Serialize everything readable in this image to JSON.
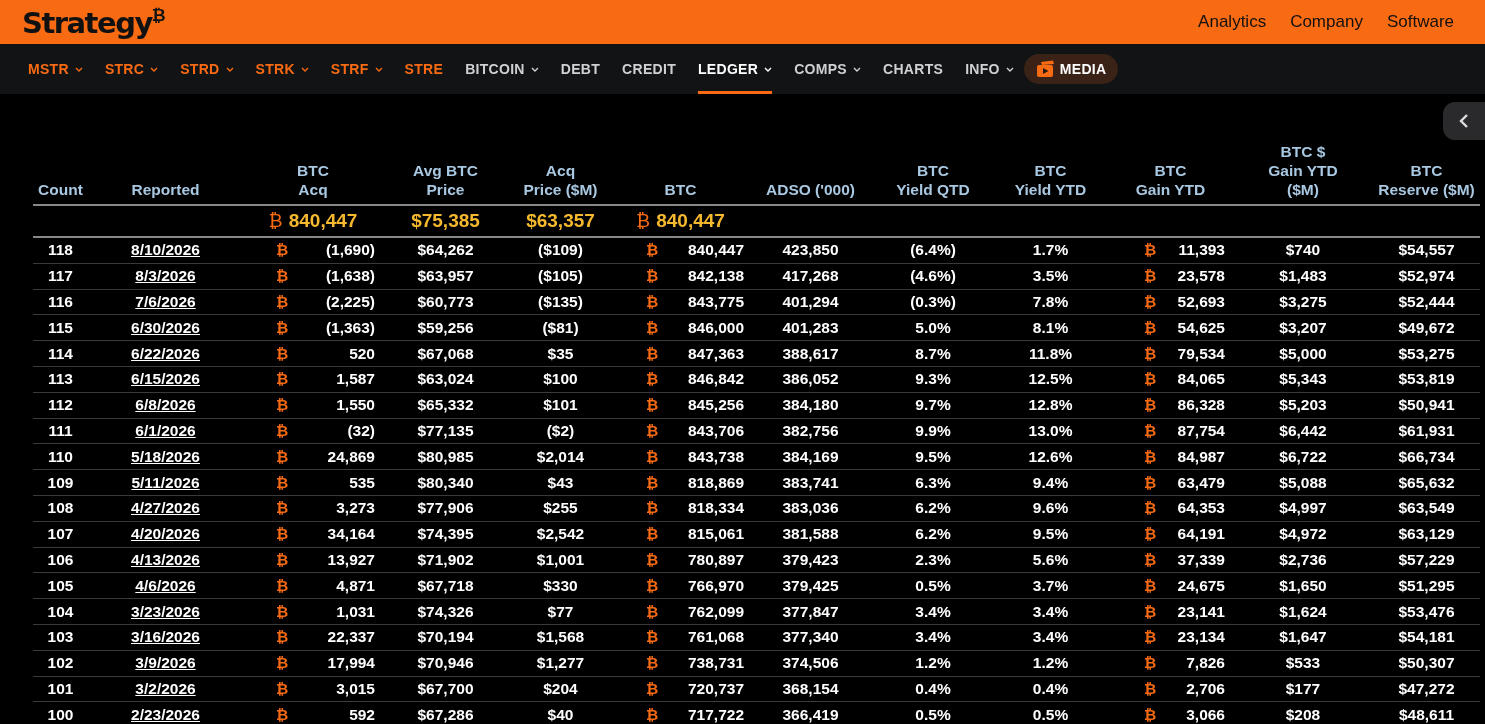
{
  "brand": {
    "logo": "Strategy$^{₿}$"
  },
  "top_links": [
    "Analytics",
    "Company",
    "Software"
  ],
  "nav": [
    {
      "label": "MSTR",
      "kind": "ticker",
      "caret": true,
      "selected": false
    },
    {
      "label": "STRC",
      "kind": "ticker",
      "caret": true,
      "selected": false
    },
    {
      "label": "STRD",
      "kind": "ticker",
      "caret": true,
      "selected": false
    },
    {
      "label": "STRK",
      "kind": "ticker",
      "caret": true,
      "selected": false
    },
    {
      "label": "STRF",
      "kind": "ticker",
      "caret": true,
      "selected": false
    },
    {
      "label": "STRE",
      "kind": "ticker",
      "caret": false,
      "selected": false
    },
    {
      "label": "BITCOIN",
      "kind": "section",
      "caret": true,
      "selected": false
    },
    {
      "label": "DEBT",
      "kind": "section",
      "caret": false,
      "selected": false
    },
    {
      "label": "CREDIT",
      "kind": "section",
      "caret": false,
      "selected": false
    },
    {
      "label": "LEDGER",
      "kind": "section",
      "caret": true,
      "selected": true
    },
    {
      "label": "COMPS",
      "kind": "section",
      "caret": true,
      "selected": false
    },
    {
      "label": "CHARTS",
      "kind": "section",
      "caret": false,
      "selected": false
    },
    {
      "label": "INFO",
      "kind": "section",
      "caret": true,
      "selected": false
    },
    {
      "label": "MEDIA",
      "kind": "media",
      "selected": false
    }
  ],
  "table": {
    "columns": [
      {
        "lines": [
          "Count"
        ],
        "kind": "text"
      },
      {
        "lines": [
          "Reported"
        ],
        "kind": "link"
      },
      {
        "lines": [
          "BTC",
          "Acq"
        ],
        "kind": "btc",
        "total": {
          "unit": "₿",
          "value": "840,447"
        }
      },
      {
        "lines": [
          "Avg BTC",
          "Price"
        ],
        "kind": "text",
        "total": "$75,385"
      },
      {
        "lines": [
          "Acq",
          "Price ($M)"
        ],
        "kind": "text",
        "total": "$63,357"
      },
      {
        "lines": [
          "BTC"
        ],
        "kind": "btc",
        "total": {
          "unit": "₿",
          "value": "840,447"
        }
      },
      {
        "lines": [
          "ADSO ('000)"
        ],
        "kind": "text"
      },
      {
        "lines": [
          "BTC",
          "Yield QTD"
        ],
        "kind": "text"
      },
      {
        "lines": [
          "BTC",
          "Yield YTD"
        ],
        "kind": "text"
      },
      {
        "lines": [
          "BTC",
          "Gain YTD"
        ],
        "kind": "btc"
      },
      {
        "lines": [
          "BTC $",
          "Gain YTD",
          "($M)"
        ],
        "kind": "text"
      },
      {
        "lines": [
          "BTC",
          "Reserve ($M)"
        ],
        "kind": "text"
      }
    ],
    "rows": [
      [
        "118",
        "8/10/2026",
        {
          "unit": "₿",
          "value": "(1,690)"
        },
        "$64,262",
        "($109)",
        {
          "unit": "₿",
          "value": "840,447"
        },
        "423,850",
        "(6.4%)",
        "1.7%",
        {
          "unit": "₿",
          "value": "11,393"
        },
        "$740",
        "$54,557"
      ],
      [
        "117",
        "8/3/2026",
        {
          "unit": "₿",
          "value": "(1,638)"
        },
        "$63,957",
        "($105)",
        {
          "unit": "₿",
          "value": "842,138"
        },
        "417,268",
        "(4.6%)",
        "3.5%",
        {
          "unit": "₿",
          "value": "23,578"
        },
        "$1,483",
        "$52,974"
      ],
      [
        "116",
        "7/6/2026",
        {
          "unit": "₿",
          "value": "(2,225)"
        },
        "$60,773",
        "($135)",
        {
          "unit": "₿",
          "value": "843,775"
        },
        "401,294",
        "(0.3%)",
        "7.8%",
        {
          "unit": "₿",
          "value": "52,693"
        },
        "$3,275",
        "$52,444"
      ],
      [
        "115",
        "6/30/2026",
        {
          "unit": "₿",
          "value": "(1,363)"
        },
        "$59,256",
        "($81)",
        {
          "unit": "₿",
          "value": "846,000"
        },
        "401,283",
        "5.0%",
        "8.1%",
        {
          "unit": "₿",
          "value": "54,625"
        },
        "$3,207",
        "$49,672"
      ],
      [
        "114",
        "6/22/2026",
        {
          "unit": "₿",
          "value": "520"
        },
        "$67,068",
        "$35",
        {
          "unit": "₿",
          "value": "847,363"
        },
        "388,617",
        "8.7%",
        "11.8%",
        {
          "unit": "₿",
          "value": "79,534"
        },
        "$5,000",
        "$53,275"
      ],
      [
        "113",
        "6/15/2026",
        {
          "unit": "₿",
          "value": "1,587"
        },
        "$63,024",
        "$100",
        {
          "unit": "₿",
          "value": "846,842"
        },
        "386,052",
        "9.3%",
        "12.5%",
        {
          "unit": "₿",
          "value": "84,065"
        },
        "$5,343",
        "$53,819"
      ],
      [
        "112",
        "6/8/2026",
        {
          "unit": "₿",
          "value": "1,550"
        },
        "$65,332",
        "$101",
        {
          "unit": "₿",
          "value": "845,256"
        },
        "384,180",
        "9.7%",
        "12.8%",
        {
          "unit": "₿",
          "value": "86,328"
        },
        "$5,203",
        "$50,941"
      ],
      [
        "111",
        "6/1/2026",
        {
          "unit": "₿",
          "value": "(32)"
        },
        "$77,135",
        "($2)",
        {
          "unit": "₿",
          "value": "843,706"
        },
        "382,756",
        "9.9%",
        "13.0%",
        {
          "unit": "₿",
          "value": "87,754"
        },
        "$6,442",
        "$61,931"
      ],
      [
        "110",
        "5/18/2026",
        {
          "unit": "₿",
          "value": "24,869"
        },
        "$80,985",
        "$2,014",
        {
          "unit": "₿",
          "value": "843,738"
        },
        "384,169",
        "9.5%",
        "12.6%",
        {
          "unit": "₿",
          "value": "84,987"
        },
        "$6,722",
        "$66,734"
      ],
      [
        "109",
        "5/11/2026",
        {
          "unit": "₿",
          "value": "535"
        },
        "$80,340",
        "$43",
        {
          "unit": "₿",
          "value": "818,869"
        },
        "383,741",
        "6.3%",
        "9.4%",
        {
          "unit": "₿",
          "value": "63,479"
        },
        "$5,088",
        "$65,632"
      ],
      [
        "108",
        "4/27/2026",
        {
          "unit": "₿",
          "value": "3,273"
        },
        "$77,906",
        "$255",
        {
          "unit": "₿",
          "value": "818,334"
        },
        "383,036",
        "6.2%",
        "9.6%",
        {
          "unit": "₿",
          "value": "64,353"
        },
        "$4,997",
        "$63,549"
      ],
      [
        "107",
        "4/20/2026",
        {
          "unit": "₿",
          "value": "34,164"
        },
        "$74,395",
        "$2,542",
        {
          "unit": "₿",
          "value": "815,061"
        },
        "381,588",
        "6.2%",
        "9.5%",
        {
          "unit": "₿",
          "value": "64,191"
        },
        "$4,972",
        "$63,129"
      ],
      [
        "106",
        "4/13/2026",
        {
          "unit": "₿",
          "value": "13,927"
        },
        "$71,902",
        "$1,001",
        {
          "unit": "₿",
          "value": "780,897"
        },
        "379,423",
        "2.3%",
        "5.6%",
        {
          "unit": "₿",
          "value": "37,339"
        },
        "$2,736",
        "$57,229"
      ],
      [
        "105",
        "4/6/2026",
        {
          "unit": "₿",
          "value": "4,871"
        },
        "$67,718",
        "$330",
        {
          "unit": "₿",
          "value": "766,970"
        },
        "379,425",
        "0.5%",
        "3.7%",
        {
          "unit": "₿",
          "value": "24,675"
        },
        "$1,650",
        "$51,295"
      ],
      [
        "104",
        "3/23/2026",
        {
          "unit": "₿",
          "value": "1,031"
        },
        "$74,326",
        "$77",
        {
          "unit": "₿",
          "value": "762,099"
        },
        "377,847",
        "3.4%",
        "3.4%",
        {
          "unit": "₿",
          "value": "23,141"
        },
        "$1,624",
        "$53,476"
      ],
      [
        "103",
        "3/16/2026",
        {
          "unit": "₿",
          "value": "22,337"
        },
        "$70,194",
        "$1,568",
        {
          "unit": "₿",
          "value": "761,068"
        },
        "377,340",
        "3.4%",
        "3.4%",
        {
          "unit": "₿",
          "value": "23,134"
        },
        "$1,647",
        "$54,181"
      ],
      [
        "102",
        "3/9/2026",
        {
          "unit": "₿",
          "value": "17,994"
        },
        "$70,946",
        "$1,277",
        {
          "unit": "₿",
          "value": "738,731"
        },
        "374,506",
        "1.2%",
        "1.2%",
        {
          "unit": "₿",
          "value": "7,826"
        },
        "$533",
        "$50,307"
      ],
      [
        "101",
        "3/2/2026",
        {
          "unit": "₿",
          "value": "3,015"
        },
        "$67,700",
        "$204",
        {
          "unit": "₿",
          "value": "720,737"
        },
        "368,154",
        "0.4%",
        "0.4%",
        {
          "unit": "₿",
          "value": "2,706"
        },
        "$177",
        "$47,272"
      ],
      [
        "100",
        "2/23/2026",
        {
          "unit": "₿",
          "value": "592"
        },
        "$67,286",
        "$40",
        {
          "unit": "₿",
          "value": "717,722"
        },
        "366,419",
        "0.5%",
        "0.5%",
        {
          "unit": "₿",
          "value": "3,066"
        },
        "$208",
        "$48,611"
      ]
    ]
  }
}
